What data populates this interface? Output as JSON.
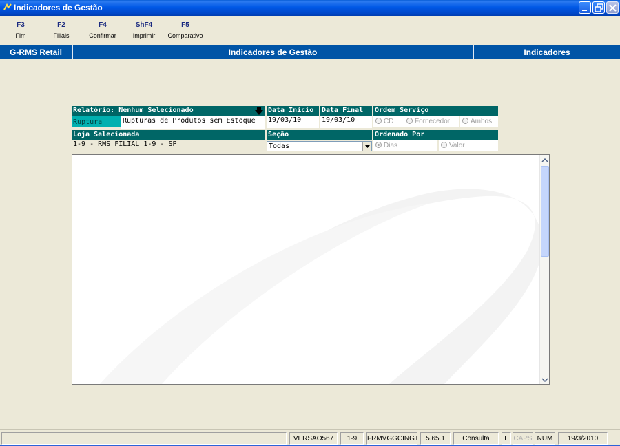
{
  "window": {
    "title": "Indicadores de Gestão"
  },
  "toolbar": [
    {
      "key": "F3",
      "label": "Fim"
    },
    {
      "key": "F2",
      "label": "Filiais"
    },
    {
      "key": "F4",
      "label": "Confirmar"
    },
    {
      "key": "ShF4",
      "label": "Imprimir"
    },
    {
      "key": "F5",
      "label": "Comparativo"
    }
  ],
  "band": {
    "left": "G-RMS Retail",
    "center": "Indicadores de Gestão",
    "right": "Indicadores"
  },
  "form": {
    "relatorio_header": "Relatório: Nenhum Selecionado",
    "relatorio_category": "Ruptura",
    "relatorio_item": "Rupturas de Produtos sem Estoque",
    "data_inicio_label": "Data Início",
    "data_inicio_value": "19/03/10",
    "data_final_label": "Data Final",
    "data_final_value": "19/03/10",
    "ordem_servico_label": "Ordem Serviço",
    "ordem_options": [
      "CD",
      "Fornecedor",
      "Ambos"
    ],
    "loja_label": "Loja Selecionada",
    "loja_value": "1-9 - RMS FILIAL 1-9 - SP",
    "secao_label": "Seção",
    "secao_value": "Todas",
    "ordenado_label": "Ordenado Por",
    "ordenado_options": [
      "Dias",
      "Valor"
    ]
  },
  "status": {
    "version": "VERSAO567",
    "store": "1-9",
    "form": "FRMVGGCINGT",
    "build": "5.65.1",
    "mode": "Consulta",
    "l": "L",
    "caps": "CAPS",
    "num": "NUM",
    "date": "19/3/2010"
  },
  "colors": {
    "accent": "#0054a6",
    "header": "#006666",
    "selected": "#00b0b0"
  }
}
